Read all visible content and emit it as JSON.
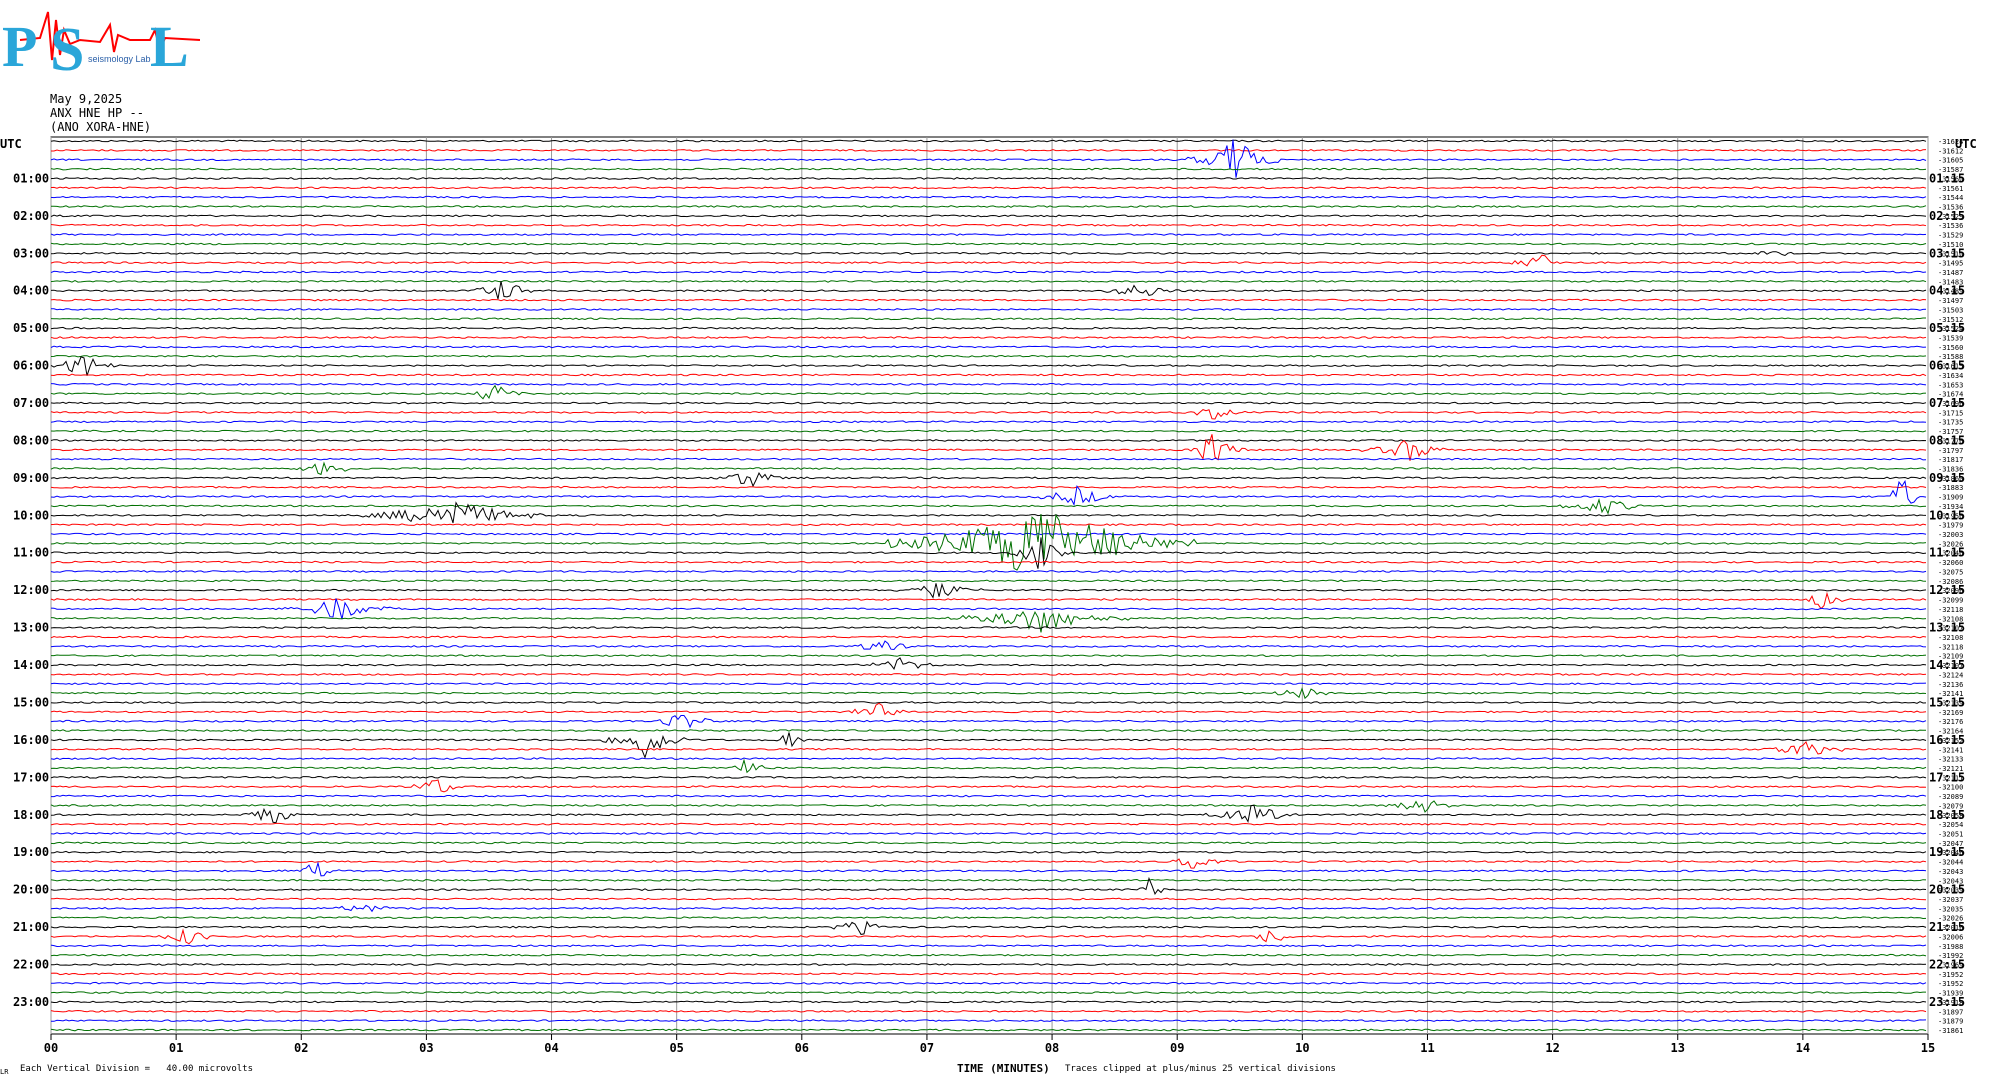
{
  "header": {
    "logo_text": "PSL",
    "logo_subtitle": "seismology Lab",
    "date": "May 9,2025",
    "station": "ANX HNE HP --",
    "network": "(ANO XORA-HNE)"
  },
  "axis": {
    "left_label": "UTC",
    "right_label": "UTC",
    "xlabel": "TIME (MINUTES)",
    "footer_division": "Each Vertical Division =   40.00 microvolts",
    "footer_clip": "Traces clipped at plus/minus 25 vertical divisions",
    "footer_mark": "LR"
  },
  "colors": {
    "trace_cycle": [
      "#000000",
      "#ff0000",
      "#0000ff",
      "#007000"
    ],
    "grid": "#999999"
  },
  "chart_data": {
    "type": "line",
    "title": "",
    "xlabel": "TIME (MINUTES)",
    "ylabel": "UTC",
    "xlim": [
      0,
      15
    ],
    "x_ticks": [
      "00",
      "01",
      "02",
      "03",
      "04",
      "05",
      "06",
      "07",
      "08",
      "09",
      "10",
      "11",
      "12",
      "13",
      "14",
      "15"
    ],
    "left_hour_labels": [
      "01:00",
      "02:00",
      "03:00",
      "04:00",
      "05:00",
      "06:00",
      "07:00",
      "08:00",
      "09:00",
      "10:00",
      "11:00",
      "12:00",
      "13:00",
      "14:00",
      "15:00",
      "16:00",
      "17:00",
      "18:00",
      "19:00",
      "20:00",
      "21:00",
      "22:00",
      "23:00"
    ],
    "right_hour_labels": [
      "01:15",
      "02:15",
      "03:15",
      "04:15",
      "05:15",
      "06:15",
      "07:15",
      "08:15",
      "09:15",
      "10:15",
      "11:15",
      "12:15",
      "13:15",
      "14:15",
      "15:15",
      "16:15",
      "17:15",
      "18:15",
      "19:15",
      "20:15",
      "21:15",
      "22:15",
      "23:15"
    ],
    "trace_count": 96,
    "trace_offsets": [
      -31624,
      -31612,
      -31605,
      -31587,
      -31560,
      -31561,
      -31544,
      -31536,
      -31529,
      -31536,
      -31529,
      -31510,
      -31510,
      -31495,
      -31487,
      -31483,
      -31489,
      -31497,
      -31503,
      -31512,
      -31524,
      -31539,
      -31560,
      -31588,
      -31615,
      -31634,
      -31653,
      -31674,
      -31696,
      -31715,
      -31735,
      -31757,
      -31776,
      -31797,
      -31817,
      -31836,
      -31860,
      -31883,
      -31909,
      -31934,
      -31956,
      -31979,
      -32003,
      -32026,
      -32046,
      -32060,
      -32075,
      -32086,
      -32096,
      -32099,
      -32118,
      -32108,
      -32107,
      -32108,
      -32118,
      -32109,
      -32107,
      -32124,
      -32136,
      -32141,
      -32139,
      -32169,
      -32176,
      -32164,
      -32152,
      -32141,
      -32133,
      -32121,
      -32111,
      -32100,
      -32089,
      -32079,
      -32058,
      -32054,
      -32051,
      -32047,
      -32046,
      -32044,
      -32043,
      -32043,
      -32039,
      -32037,
      -32035,
      -32026,
      -32016,
      -32006,
      -31988,
      -31992,
      -31969,
      -31952,
      -31952,
      -31939,
      -31918,
      -31897,
      -31879,
      -31861
    ],
    "events": [
      {
        "trace": 2,
        "minute": 9.45,
        "amp": 1.0,
        "width": 0.15
      },
      {
        "trace": 13,
        "minute": 11.9,
        "amp": 0.4,
        "width": 0.1
      },
      {
        "trace": 12,
        "minute": 13.8,
        "amp": 0.3,
        "width": 0.1
      },
      {
        "trace": 16,
        "minute": 3.6,
        "amp": 0.5,
        "width": 0.12
      },
      {
        "trace": 16,
        "minute": 8.7,
        "amp": 0.35,
        "width": 0.15
      },
      {
        "trace": 24,
        "minute": 0.25,
        "amp": 0.5,
        "width": 0.12
      },
      {
        "trace": 27,
        "minute": 3.55,
        "amp": 0.5,
        "width": 0.1
      },
      {
        "trace": 29,
        "minute": 9.3,
        "amp": 0.3,
        "width": 0.1
      },
      {
        "trace": 33,
        "minute": 9.3,
        "amp": 0.8,
        "width": 0.1
      },
      {
        "trace": 33,
        "minute": 10.85,
        "amp": 0.5,
        "width": 0.15
      },
      {
        "trace": 35,
        "minute": 2.2,
        "amp": 0.4,
        "width": 0.1
      },
      {
        "trace": 36,
        "minute": 5.6,
        "amp": 0.5,
        "width": 0.12
      },
      {
        "trace": 38,
        "minute": 8.2,
        "amp": 0.4,
        "width": 0.15
      },
      {
        "trace": 38,
        "minute": 14.8,
        "amp": 1.2,
        "width": 0.05
      },
      {
        "trace": 39,
        "minute": 12.4,
        "amp": 0.4,
        "width": 0.15
      },
      {
        "trace": 40,
        "minute": 3.2,
        "amp": 0.7,
        "width": 0.3
      },
      {
        "trace": 43,
        "minute": 7.9,
        "amp": 1.6,
        "width": 0.5
      },
      {
        "trace": 44,
        "minute": 7.9,
        "amp": 0.7,
        "width": 0.1
      },
      {
        "trace": 48,
        "minute": 7.1,
        "amp": 0.4,
        "width": 0.15
      },
      {
        "trace": 49,
        "minute": 14.15,
        "amp": 0.4,
        "width": 0.1
      },
      {
        "trace": 50,
        "minute": 2.3,
        "amp": 0.5,
        "width": 0.2
      },
      {
        "trace": 51,
        "minute": 7.9,
        "amp": 0.6,
        "width": 0.3
      },
      {
        "trace": 54,
        "minute": 6.65,
        "amp": 0.4,
        "width": 0.1
      },
      {
        "trace": 56,
        "minute": 6.8,
        "amp": 0.5,
        "width": 0.1
      },
      {
        "trace": 59,
        "minute": 10.0,
        "amp": 0.3,
        "width": 0.1
      },
      {
        "trace": 61,
        "minute": 6.6,
        "amp": 0.4,
        "width": 0.1
      },
      {
        "trace": 62,
        "minute": 5.05,
        "amp": 0.4,
        "width": 0.12
      },
      {
        "trace": 64,
        "minute": 4.75,
        "amp": 0.8,
        "width": 0.15
      },
      {
        "trace": 64,
        "minute": 5.9,
        "amp": 0.4,
        "width": 0.06
      },
      {
        "trace": 65,
        "minute": 14.0,
        "amp": 0.4,
        "width": 0.15
      },
      {
        "trace": 67,
        "minute": 5.55,
        "amp": 0.4,
        "width": 0.08
      },
      {
        "trace": 69,
        "minute": 3.1,
        "amp": 0.4,
        "width": 0.1
      },
      {
        "trace": 72,
        "minute": 1.75,
        "amp": 0.5,
        "width": 0.1
      },
      {
        "trace": 72,
        "minute": 9.6,
        "amp": 0.4,
        "width": 0.2
      },
      {
        "trace": 71,
        "minute": 10.95,
        "amp": 0.4,
        "width": 0.12
      },
      {
        "trace": 77,
        "minute": 9.15,
        "amp": 0.4,
        "width": 0.1
      },
      {
        "trace": 78,
        "minute": 2.1,
        "amp": 0.4,
        "width": 0.1
      },
      {
        "trace": 80,
        "minute": 8.8,
        "amp": 1.2,
        "width": 0.04
      },
      {
        "trace": 82,
        "minute": 2.5,
        "amp": 0.3,
        "width": 0.1
      },
      {
        "trace": 84,
        "minute": 6.45,
        "amp": 0.4,
        "width": 0.1
      },
      {
        "trace": 85,
        "minute": 1.1,
        "amp": 0.4,
        "width": 0.1
      },
      {
        "trace": 85,
        "minute": 9.75,
        "amp": 0.35,
        "width": 0.1
      }
    ]
  }
}
